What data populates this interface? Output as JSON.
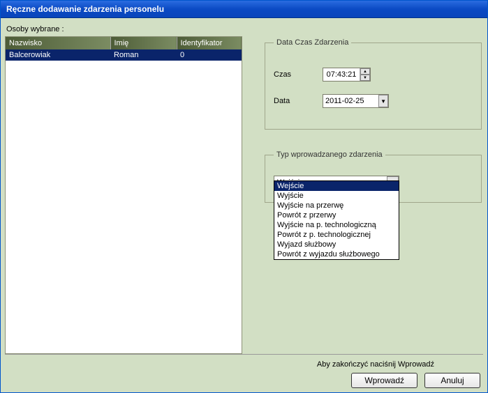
{
  "window": {
    "title": "Ręczne dodawanie zdarzenia personelu"
  },
  "selected_people": {
    "label": "Osoby wybrane :",
    "columns": [
      "Nazwisko",
      "Imię",
      "Identyfikator"
    ],
    "rows": [
      {
        "surname": "Balcerowiak",
        "firstname": "Roman",
        "id": "0"
      }
    ]
  },
  "datetime": {
    "legend": "Data Czas Zdarzenia",
    "time_label": "Czas",
    "time_value": "07:43:21",
    "date_label": "Data",
    "date_value": "2011-02-25"
  },
  "event_type": {
    "legend": "Typ wprowadzanego zdarzenia",
    "selected": "Wejście",
    "options": [
      "Wejście",
      "Wyjście",
      "Wyjście na przerwę",
      "Powrót z przerwy",
      "Wyjście na p. technologiczną",
      "Powrót z p. technologicznej",
      "Wyjazd służbowy",
      "Powrót z wyjazdu służbowego"
    ]
  },
  "footer": {
    "hint": "Aby zakończyć naciśnij Wprowadź",
    "ok_label": "Wprowadź",
    "cancel_label": "Anuluj"
  }
}
